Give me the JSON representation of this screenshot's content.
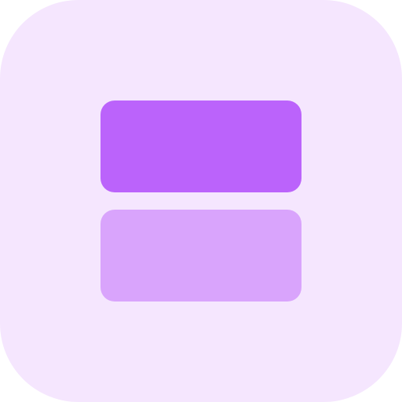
{
  "icon": {
    "name": "split-rows-icon",
    "colors": {
      "background": "#f5e6fe",
      "top_tile": "#bb63fb",
      "bottom_tile": "#d9a4fc"
    }
  }
}
